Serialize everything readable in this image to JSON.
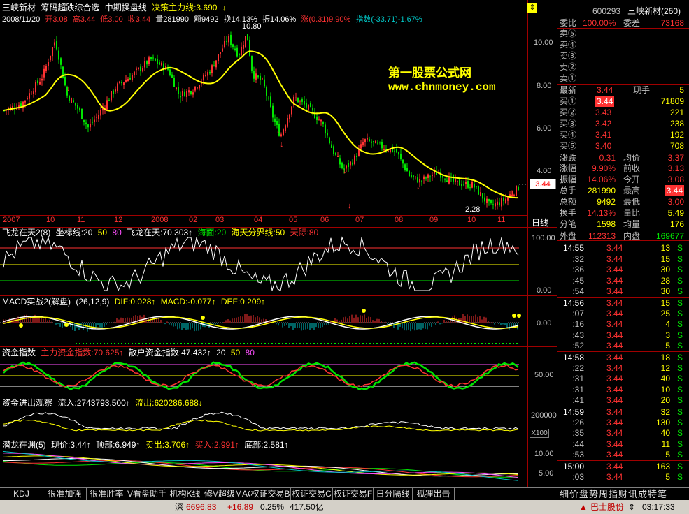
{
  "header": {
    "stock_name": "三峡新材",
    "indicator_label": "筹码超跌综合选",
    "period_label": "中期操盘线",
    "decision_line": "决策主力线:3.690",
    "date": "2008/11/20",
    "open": "开3.08",
    "high": "高3.44",
    "low": "低3.00",
    "close": "收3.44",
    "volume": "量281990",
    "amount": "额9492",
    "turnover": "换14.13%",
    "amplitude": "振14.06%",
    "change": "涨(0.31)9.90%",
    "index": "指数(-33.71)-1.67%"
  },
  "watermark": {
    "line1": "第一股票公式网",
    "line2": "www.chnmoney.com"
  },
  "price_axis": {
    "ticks": [
      "10.00",
      "8.00",
      "6.00",
      "4.00"
    ],
    "current_price": "3.44",
    "peak_label": "10.80",
    "trough_label": "2.28"
  },
  "time_axis": {
    "labels": [
      "2007",
      "10",
      "11",
      "12",
      "2008",
      "02",
      "03",
      "04",
      "05",
      "06",
      "07",
      "08",
      "09",
      "10",
      "11"
    ],
    "period_button": "日线"
  },
  "panels": {
    "p1": {
      "name": "飞龙在天2(8)",
      "coord": "坐标线:20",
      "v50": "50",
      "v80": "80",
      "value": "飞龙在天:70.303↑",
      "sea": "海面:20",
      "boundary": "海天分界线:50",
      "sky": "天际:80",
      "axis": [
        "100.00",
        "0.00"
      ]
    },
    "p2": {
      "name": "MACD实战2(解盘)",
      "params": "(26,12,9)",
      "dif": "DIF:0.028↑",
      "macd": "MACD:-0.077↑",
      "def": "DEF:0.209↑",
      "axis": [
        "0.00"
      ]
    },
    "p3": {
      "name": "资金指数",
      "main": "主力资金指数:70.625↑",
      "retail": "散户资金指数:47.432↑",
      "v20": "20",
      "v50": "50",
      "v80": "80",
      "axis": [
        "50.00"
      ]
    },
    "p4": {
      "name": "资金进出观察",
      "inflow": "流入:2743793.500↑",
      "outflow": "流出:620286.688↓",
      "axis": [
        "200000",
        "X100"
      ]
    },
    "p5": {
      "name": "潜龙在渊(5)",
      "price": "现价:3.44↑",
      "top": "顶部:6.949↑",
      "sell": "卖出:3.706↑",
      "buy": "买入:2.991↑",
      "bottom": "底部:2.581↑",
      "axis": [
        "10.00",
        "5.00"
      ]
    }
  },
  "quote": {
    "code": "600293",
    "name": "三峡新材(260)",
    "ratio_label": "委比",
    "ratio_value": "100.00%",
    "diff_label": "委差",
    "diff_value": "73168",
    "asks": [
      {
        "label": "卖⑤",
        "price": "",
        "vol": ""
      },
      {
        "label": "卖④",
        "price": "",
        "vol": ""
      },
      {
        "label": "卖③",
        "price": "",
        "vol": ""
      },
      {
        "label": "卖②",
        "price": "",
        "vol": ""
      },
      {
        "label": "卖①",
        "price": "",
        "vol": ""
      }
    ],
    "latest_label": "最新",
    "latest_value": "3.44",
    "now_label": "现手",
    "now_value": "5",
    "bids": [
      {
        "label": "买①",
        "price": "3.44",
        "vol": "71809"
      },
      {
        "label": "买②",
        "price": "3.43",
        "vol": "221"
      },
      {
        "label": "买③",
        "price": "3.42",
        "vol": "238"
      },
      {
        "label": "买④",
        "price": "3.41",
        "vol": "192"
      },
      {
        "label": "买⑤",
        "price": "3.40",
        "vol": "708"
      }
    ],
    "stats": [
      {
        "l1": "涨跌",
        "v1": "0.31",
        "l2": "均价",
        "v2": "3.37"
      },
      {
        "l1": "涨幅",
        "v1": "9.90%",
        "l2": "前收",
        "v2": "3.13"
      },
      {
        "l1": "振幅",
        "v1": "14.06%",
        "l2": "今开",
        "v2": "3.08"
      },
      {
        "l1": "总手",
        "v1": "281990",
        "l2": "最高",
        "v2": "3.44"
      },
      {
        "l1": "总额",
        "v1": "9492",
        "l2": "最低",
        "v2": "3.00"
      },
      {
        "l1": "换手",
        "v1": "14.13%",
        "l2": "量比",
        "v2": "5.49"
      },
      {
        "l1": "分笔",
        "v1": "1598",
        "l2": "均量",
        "v2": "176"
      }
    ],
    "outer_label": "外盘",
    "outer_value": "112313",
    "inner_label": "内盘",
    "inner_value": "169677"
  },
  "ticks": [
    {
      "t": "14:55",
      "p": "3.44",
      "v": "13",
      "s": "S"
    },
    {
      "t": ":32",
      "p": "3.44",
      "v": "15",
      "s": "S"
    },
    {
      "t": ":36",
      "p": "3.44",
      "v": "30",
      "s": "S"
    },
    {
      "t": ":45",
      "p": "3.44",
      "v": "28",
      "s": "S"
    },
    {
      "t": ":54",
      "p": "3.44",
      "v": "30",
      "s": "S"
    },
    {
      "t": "14:56",
      "p": "3.44",
      "v": "15",
      "s": "S"
    },
    {
      "t": ":07",
      "p": "3.44",
      "v": "25",
      "s": "S"
    },
    {
      "t": ":16",
      "p": "3.44",
      "v": "4",
      "s": "S"
    },
    {
      "t": ":43",
      "p": "3.44",
      "v": "3",
      "s": "S"
    },
    {
      "t": ":52",
      "p": "3.44",
      "v": "5",
      "s": "S"
    },
    {
      "t": "14:58",
      "p": "3.44",
      "v": "18",
      "s": "S"
    },
    {
      "t": ":22",
      "p": "3.44",
      "v": "12",
      "s": "S"
    },
    {
      "t": ":31",
      "p": "3.44",
      "v": "40",
      "s": "S"
    },
    {
      "t": ":31",
      "p": "3.44",
      "v": "10",
      "s": "S"
    },
    {
      "t": ":41",
      "p": "3.44",
      "v": "20",
      "s": "S"
    },
    {
      "t": "14:59",
      "p": "3.44",
      "v": "32",
      "s": "S"
    },
    {
      "t": ":26",
      "p": "3.44",
      "v": "130",
      "s": "S"
    },
    {
      "t": ":35",
      "p": "3.44",
      "v": "40",
      "s": "S"
    },
    {
      "t": ":44",
      "p": "3.44",
      "v": "11",
      "s": "S"
    },
    {
      "t": ":53",
      "p": "3.44",
      "v": "5",
      "s": "S"
    },
    {
      "t": "15:00",
      "p": "3.44",
      "v": "163",
      "s": "S"
    },
    {
      "t": ":03",
      "p": "3.44",
      "v": "5",
      "s": "S"
    }
  ],
  "tabs": [
    "KDJ",
    "很准加强",
    "很准胜率",
    "V看盘助手",
    "机构K线",
    "修V超级MACD",
    "权证交易B",
    "权证交易C",
    "权证交易F",
    "日分隔线",
    "狐狸出击"
  ],
  "right_tabs": "细价盘势周指财讯成特笔",
  "status": {
    "index_name": "深",
    "index_value": "6696.83",
    "index_change": "+16.89",
    "index_pct": "0.25%",
    "index_amount": "417.50亿",
    "ticker": "巴士股份",
    "clock": "03:17:33"
  }
}
